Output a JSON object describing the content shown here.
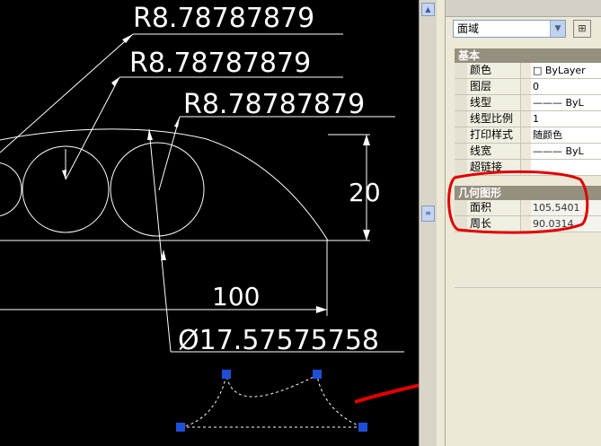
{
  "drawing": {
    "radius_labels": [
      "R8.78787879",
      "R8.78787879",
      "R8.78787879"
    ],
    "height_dim": "20",
    "width_dim": "100",
    "diameter_dim": "Ø17.57575758"
  },
  "palette": {
    "object_type": "面域",
    "categories": {
      "basic": {
        "title": "基本",
        "rows": [
          {
            "label": "颜色",
            "value": "□ ByLayer"
          },
          {
            "label": "图层",
            "value": "0"
          },
          {
            "label": "线型",
            "value": "——— ByL"
          },
          {
            "label": "线型比例",
            "value": "1"
          },
          {
            "label": "打印样式",
            "value": "随颜色"
          },
          {
            "label": "线宽",
            "value": "——— ByL"
          },
          {
            "label": "超链接",
            "value": ""
          }
        ]
      },
      "geometry": {
        "title": "几何图形",
        "rows": [
          {
            "label": "面积",
            "value": "105.5401"
          },
          {
            "label": "周长",
            "value": "90.0314"
          }
        ]
      }
    }
  },
  "colors": {
    "canvas_bg": "#000000",
    "grip": "#1f4fd8",
    "annotation": "#e00000"
  }
}
